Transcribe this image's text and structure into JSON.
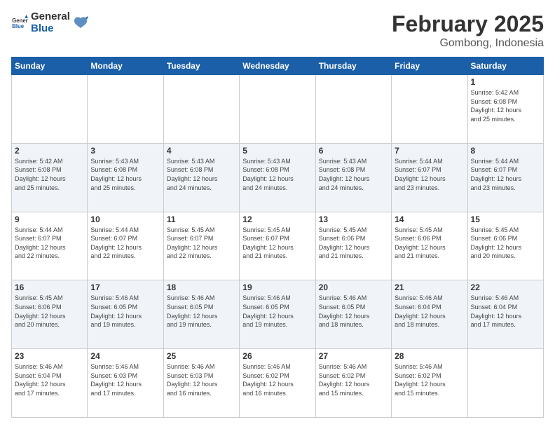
{
  "header": {
    "logo_general": "General",
    "logo_blue": "Blue",
    "month": "February 2025",
    "location": "Gombong, Indonesia"
  },
  "days_of_week": [
    "Sunday",
    "Monday",
    "Tuesday",
    "Wednesday",
    "Thursday",
    "Friday",
    "Saturday"
  ],
  "weeks": [
    [
      {
        "day": "",
        "info": ""
      },
      {
        "day": "",
        "info": ""
      },
      {
        "day": "",
        "info": ""
      },
      {
        "day": "",
        "info": ""
      },
      {
        "day": "",
        "info": ""
      },
      {
        "day": "",
        "info": ""
      },
      {
        "day": "1",
        "info": "Sunrise: 5:42 AM\nSunset: 6:08 PM\nDaylight: 12 hours\nand 25 minutes."
      }
    ],
    [
      {
        "day": "2",
        "info": "Sunrise: 5:42 AM\nSunset: 6:08 PM\nDaylight: 12 hours\nand 25 minutes."
      },
      {
        "day": "3",
        "info": "Sunrise: 5:43 AM\nSunset: 6:08 PM\nDaylight: 12 hours\nand 25 minutes."
      },
      {
        "day": "4",
        "info": "Sunrise: 5:43 AM\nSunset: 6:08 PM\nDaylight: 12 hours\nand 24 minutes."
      },
      {
        "day": "5",
        "info": "Sunrise: 5:43 AM\nSunset: 6:08 PM\nDaylight: 12 hours\nand 24 minutes."
      },
      {
        "day": "6",
        "info": "Sunrise: 5:43 AM\nSunset: 6:08 PM\nDaylight: 12 hours\nand 24 minutes."
      },
      {
        "day": "7",
        "info": "Sunrise: 5:44 AM\nSunset: 6:07 PM\nDaylight: 12 hours\nand 23 minutes."
      },
      {
        "day": "8",
        "info": "Sunrise: 5:44 AM\nSunset: 6:07 PM\nDaylight: 12 hours\nand 23 minutes."
      }
    ],
    [
      {
        "day": "9",
        "info": "Sunrise: 5:44 AM\nSunset: 6:07 PM\nDaylight: 12 hours\nand 22 minutes."
      },
      {
        "day": "10",
        "info": "Sunrise: 5:44 AM\nSunset: 6:07 PM\nDaylight: 12 hours\nand 22 minutes."
      },
      {
        "day": "11",
        "info": "Sunrise: 5:45 AM\nSunset: 6:07 PM\nDaylight: 12 hours\nand 22 minutes."
      },
      {
        "day": "12",
        "info": "Sunrise: 5:45 AM\nSunset: 6:07 PM\nDaylight: 12 hours\nand 21 minutes."
      },
      {
        "day": "13",
        "info": "Sunrise: 5:45 AM\nSunset: 6:06 PM\nDaylight: 12 hours\nand 21 minutes."
      },
      {
        "day": "14",
        "info": "Sunrise: 5:45 AM\nSunset: 6:06 PM\nDaylight: 12 hours\nand 21 minutes."
      },
      {
        "day": "15",
        "info": "Sunrise: 5:45 AM\nSunset: 6:06 PM\nDaylight: 12 hours\nand 20 minutes."
      }
    ],
    [
      {
        "day": "16",
        "info": "Sunrise: 5:45 AM\nSunset: 6:06 PM\nDaylight: 12 hours\nand 20 minutes."
      },
      {
        "day": "17",
        "info": "Sunrise: 5:46 AM\nSunset: 6:05 PM\nDaylight: 12 hours\nand 19 minutes."
      },
      {
        "day": "18",
        "info": "Sunrise: 5:46 AM\nSunset: 6:05 PM\nDaylight: 12 hours\nand 19 minutes."
      },
      {
        "day": "19",
        "info": "Sunrise: 5:46 AM\nSunset: 6:05 PM\nDaylight: 12 hours\nand 19 minutes."
      },
      {
        "day": "20",
        "info": "Sunrise: 5:46 AM\nSunset: 6:05 PM\nDaylight: 12 hours\nand 18 minutes."
      },
      {
        "day": "21",
        "info": "Sunrise: 5:46 AM\nSunset: 6:04 PM\nDaylight: 12 hours\nand 18 minutes."
      },
      {
        "day": "22",
        "info": "Sunrise: 5:46 AM\nSunset: 6:04 PM\nDaylight: 12 hours\nand 17 minutes."
      }
    ],
    [
      {
        "day": "23",
        "info": "Sunrise: 5:46 AM\nSunset: 6:04 PM\nDaylight: 12 hours\nand 17 minutes."
      },
      {
        "day": "24",
        "info": "Sunrise: 5:46 AM\nSunset: 6:03 PM\nDaylight: 12 hours\nand 17 minutes."
      },
      {
        "day": "25",
        "info": "Sunrise: 5:46 AM\nSunset: 6:03 PM\nDaylight: 12 hours\nand 16 minutes."
      },
      {
        "day": "26",
        "info": "Sunrise: 5:46 AM\nSunset: 6:02 PM\nDaylight: 12 hours\nand 16 minutes."
      },
      {
        "day": "27",
        "info": "Sunrise: 5:46 AM\nSunset: 6:02 PM\nDaylight: 12 hours\nand 15 minutes."
      },
      {
        "day": "28",
        "info": "Sunrise: 5:46 AM\nSunset: 6:02 PM\nDaylight: 12 hours\nand 15 minutes."
      },
      {
        "day": "",
        "info": ""
      }
    ]
  ]
}
